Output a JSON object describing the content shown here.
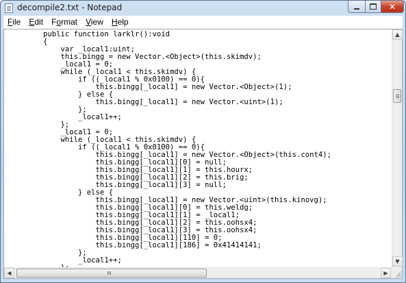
{
  "window": {
    "title": "decompile2.txt - Notepad",
    "controls": {
      "minimize": "",
      "maximize": "",
      "close": "✕"
    }
  },
  "menu": [
    {
      "label_underlined": "F",
      "label_rest": "ile"
    },
    {
      "label_underlined": "E",
      "label_rest": "dit"
    },
    {
      "label_prefix": "F",
      "label_underlined": "o",
      "label_rest": "rmat"
    },
    {
      "label_underlined": "V",
      "label_rest": "iew"
    },
    {
      "label_underlined": "H",
      "label_rest": "elp"
    }
  ],
  "editor": {
    "lines": [
      "        public function larklr():void",
      "        {",
      "            var _local1:uint;",
      "            this.bingg = new Vector.<Object>(this.skimdv);",
      "            _local1 = 0;",
      "            while (_local1 < this.skimdv) {",
      "                if ((_local1 % 0x0100) == 0){",
      "                    this.bingg[_local1] = new Vector.<Object>(1);",
      "                } else {",
      "                    this.bingg[_local1] = new Vector.<uint>(1);",
      "                };",
      "                _local1++;",
      "            };",
      "            _local1 = 0;",
      "            while (_local1 < this.skimdv) {",
      "                if ((_local1 % 0x0100) == 0){",
      "                    this.bingg[_local1] = new Vector.<Object>(this.cont4);",
      "                    this.bingg[_local1][0] = null;",
      "                    this.bingg[_local1][1] = this.hourx;",
      "                    this.bingg[_local1][2] = this.brig;",
      "                    this.bingg[_local1][3] = null;",
      "                } else {",
      "                    this.bingg[_local1] = new Vector.<uint>(this.kinovg);",
      "                    this.bingg[_local1][0] = this.weldg;",
      "                    this.bingg[_local1][1] = _local1;",
      "                    this.bingg[_local1][2] = this.oohsx4;",
      "                    this.bingg[_local1][3] = this.oohsx4;",
      "                    this.bingg[_local1][110] = 0;",
      "                    this.bingg[_local1][186] = 0x41414141;",
      "                };",
      "                _local1++;",
      "            };",
      "        }"
    ]
  },
  "scrollbars": {
    "up_arrow": "▲",
    "down_arrow": "▼",
    "left_arrow": "◀",
    "right_arrow": "▶"
  }
}
